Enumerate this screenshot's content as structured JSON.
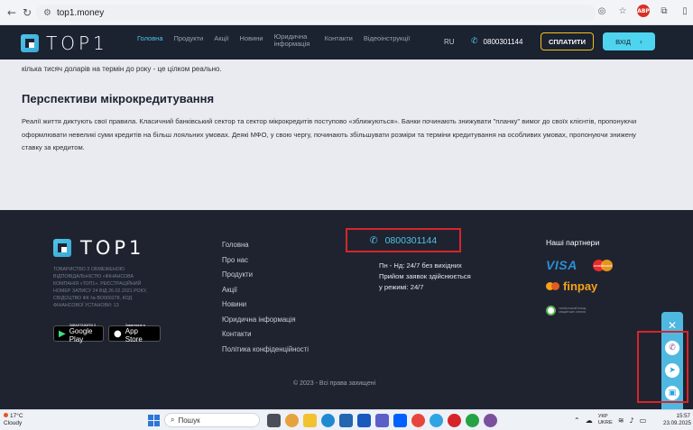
{
  "browser": {
    "url": "top1.money",
    "back_icon": "arrow-left",
    "forward_icon": "arrow-right",
    "reload_icon": "reload"
  },
  "header": {
    "logo_text": "TOP1",
    "menu": [
      {
        "label": "Головна",
        "active": true
      },
      {
        "label": "Продукти",
        "active": false
      },
      {
        "label": "Акції",
        "active": false
      },
      {
        "label": "Новини",
        "active": false
      },
      {
        "label": "Юридична інформація",
        "active": false
      },
      {
        "label": "Контакти",
        "active": false
      },
      {
        "label": "Відеоінструкції",
        "active": false
      }
    ],
    "lang": "RU",
    "phone": "0800301144",
    "pay_label": "СПЛАТИТИ",
    "login_label": "ВХІД",
    "accent_color": "#4fc4e8",
    "pay_border_color": "#f3c21b"
  },
  "article": {
    "top_line": "кілька тисяч доларів на термін до року - це цілком реально.",
    "heading": "Перспективи мікрокредитування",
    "paragraph": "Реалії життя диктують свої правила. Класичний банківський сектор та сектор мікрокредитів поступово «зближуються». Банки починають знижувати \"планку\" вимог до своїх клієнтів, пропонуючи оформлювати невеликі суми кредитів на більш лояльних умовах. Деякі МФО, у свою чергу, починають збільшувати розміри та терміни кредитування на особливих умовах, пропонуючи знижену ставку за кредитом."
  },
  "footer": {
    "logo_text": "TOP1",
    "legal": "ТОВАРИСТВО З ОБМЕЖЕНОЮ ВІДПОВІДАЛЬНІСТЮ «ФІНАНСОВА КОМПАНІЯ «ТОП1». Реєстраційний номер запису 24 від 26.02.2021 року, свідоцтво ФК № ВО000278, код фінансової установи: 13",
    "google_play": {
      "small": "ЗАВАНТАЖИТИ З",
      "big": "Google Play"
    },
    "app_store": {
      "small": "Завантажте в",
      "big": "App Store"
    },
    "links": [
      "Головна",
      "Про нас",
      "Продукти",
      "Акції",
      "Новини",
      "Юридична інформація",
      "Контакти",
      "Політика конфіденційності"
    ],
    "phone": "0800301144",
    "hours": [
      "Пн - Нд: 24/7 без вихідних",
      "Прийом заявок здійснюється",
      "у режимі: 24/7"
    ],
    "partners_title": "Наші партнери",
    "partners": {
      "visa": "VISA",
      "mastercard": "mastercard",
      "finpay": "finpay",
      "fund": "УКРАЇНСЬКИЙ ФОНД КРЕДИТНИХ СПІЛОК"
    },
    "copyright": "© 2023 - Всі права захищені",
    "highlight_color": "#d6252a"
  },
  "widget": {
    "close_icon": "close",
    "buttons": [
      "viber",
      "telegram",
      "site"
    ],
    "color": "#4fb8e0"
  },
  "taskbar": {
    "temperature": "17°C",
    "weather": "Cloudy",
    "search_placeholder": "Пошук",
    "lang_top": "УКР",
    "lang_bottom": "UKRE",
    "time": "15:57",
    "date": "23.09.2025"
  }
}
